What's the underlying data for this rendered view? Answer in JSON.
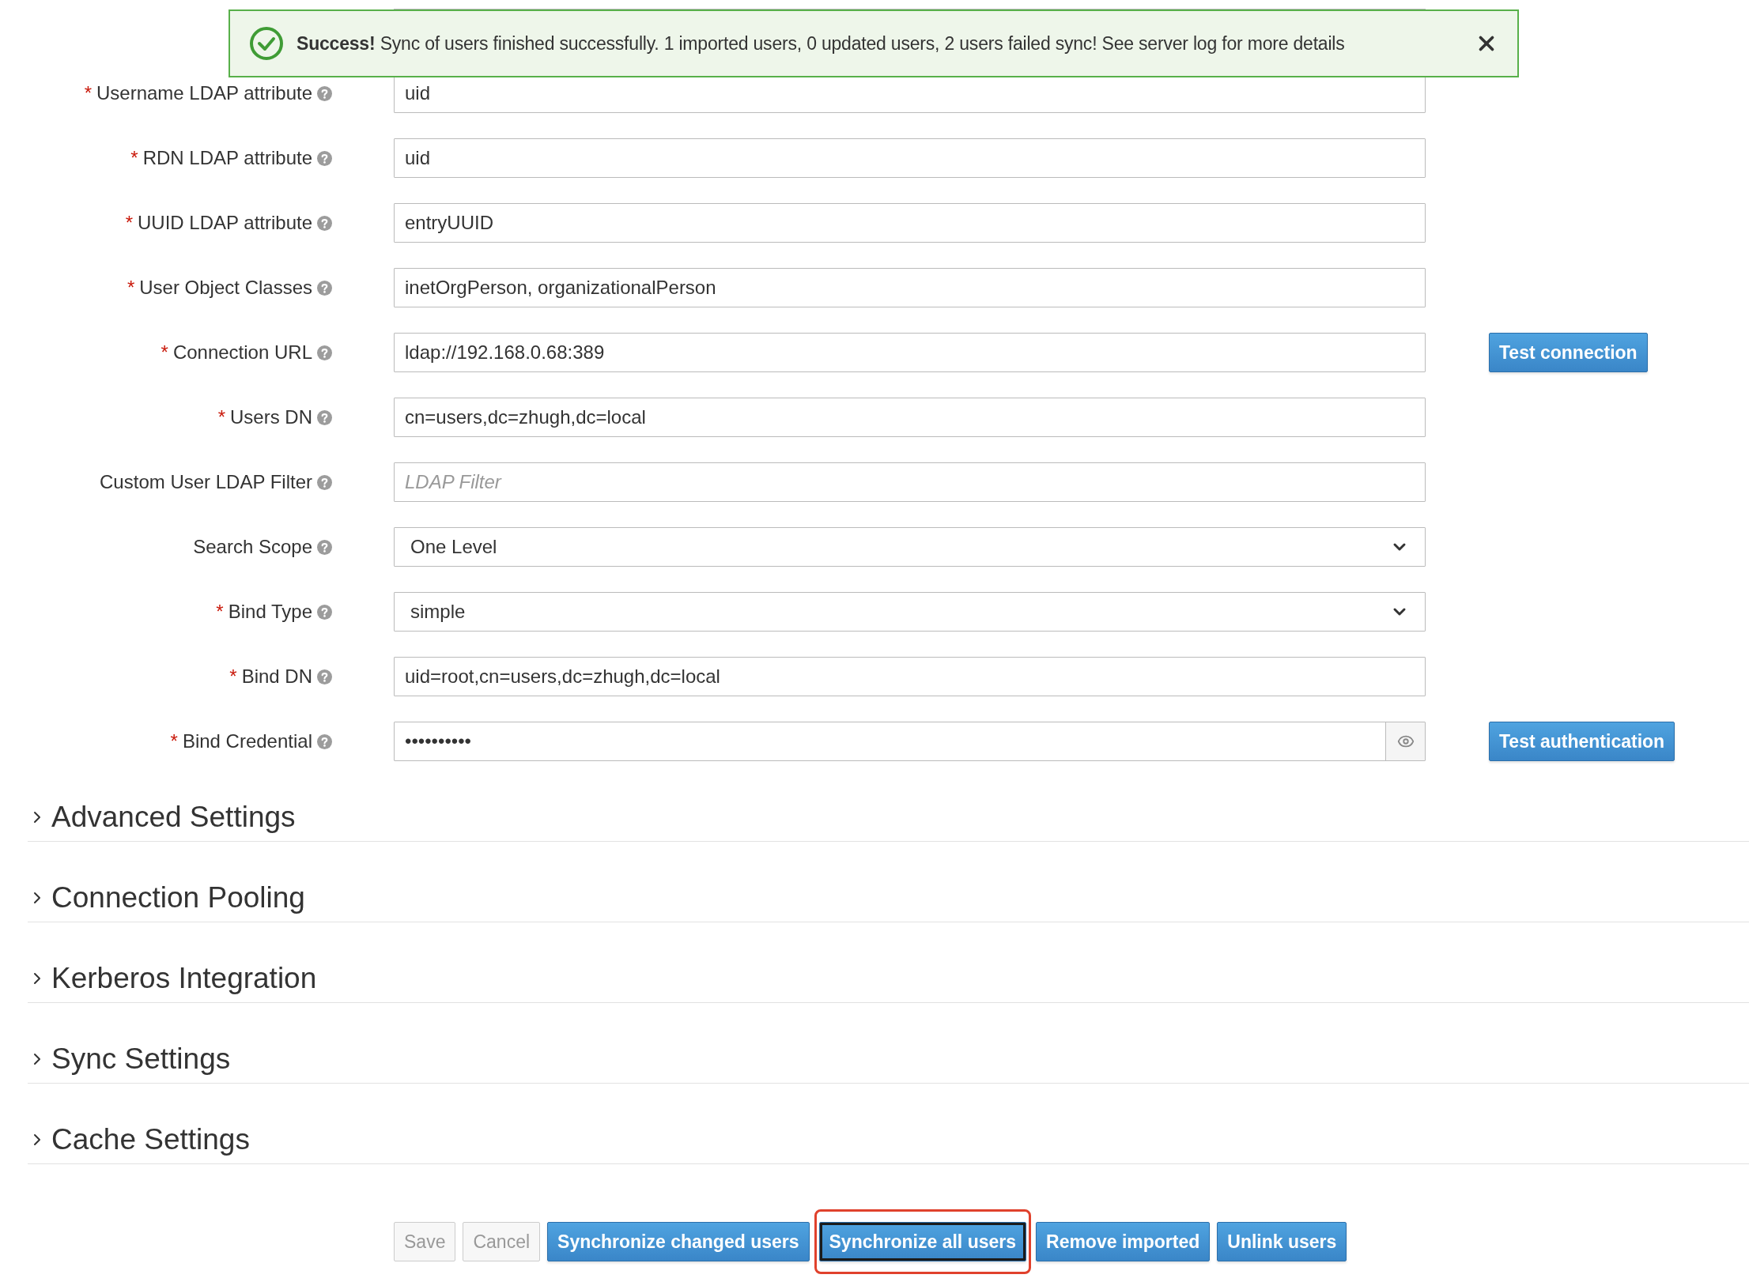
{
  "alert": {
    "kind": "success",
    "title": "Success!",
    "message": "Sync of users finished successfully. 1 imported users, 0 updated users, 2 users failed sync! See server log for more details"
  },
  "fields": [
    {
      "kind": "text",
      "required_mark": "*",
      "label": "Username LDAP attribute",
      "value": "uid"
    },
    {
      "kind": "text",
      "required_mark": "*",
      "label": "RDN LDAP attribute",
      "value": "uid"
    },
    {
      "kind": "text",
      "required_mark": "*",
      "label": "UUID LDAP attribute",
      "value": "entryUUID"
    },
    {
      "kind": "text",
      "required_mark": "*",
      "label": "User Object Classes",
      "value": "inetOrgPerson, organizationalPerson"
    },
    {
      "kind": "text",
      "required_mark": "*",
      "label": "Connection URL",
      "value": "ldap://192.168.0.68:389",
      "button": "Test connection"
    },
    {
      "kind": "text",
      "required_mark": "*",
      "label": "Users DN",
      "value": "cn=users,dc=zhugh,dc=local"
    },
    {
      "kind": "text",
      "label": "Custom User LDAP Filter",
      "placeholder": "LDAP Filter"
    },
    {
      "kind": "select",
      "label": "Search Scope",
      "value": "One Level"
    },
    {
      "kind": "select",
      "required_mark": "*",
      "label": "Bind Type",
      "value": "simple"
    },
    {
      "kind": "text",
      "required_mark": "*",
      "label": "Bind DN",
      "value": "uid=root,cn=users,dc=zhugh,dc=local"
    },
    {
      "kind": "password",
      "required_mark": "*",
      "label": "Bind Credential",
      "value": "••••••••••",
      "button": "Test authentication"
    }
  ],
  "sections": [
    {
      "title": "Advanced Settings",
      "expanded": false
    },
    {
      "title": "Connection Pooling",
      "expanded": false
    },
    {
      "title": "Kerberos Integration",
      "expanded": false
    },
    {
      "title": "Sync Settings",
      "expanded": false
    },
    {
      "title": "Cache Settings",
      "expanded": false
    }
  ],
  "buttons": [
    {
      "label": "Save",
      "disabled": true,
      "focused": false,
      "highlighted": false
    },
    {
      "label": "Cancel",
      "disabled": true,
      "focused": false,
      "highlighted": false
    },
    {
      "label": "Synchronize changed users",
      "disabled": false,
      "focused": false,
      "highlighted": false
    },
    {
      "label": "Synchronize all users",
      "disabled": false,
      "focused": true,
      "highlighted": true
    },
    {
      "label": "Remove imported",
      "disabled": false,
      "focused": false,
      "highlighted": false
    },
    {
      "label": "Unlink users",
      "disabled": false,
      "focused": false,
      "highlighted": false
    }
  ]
}
